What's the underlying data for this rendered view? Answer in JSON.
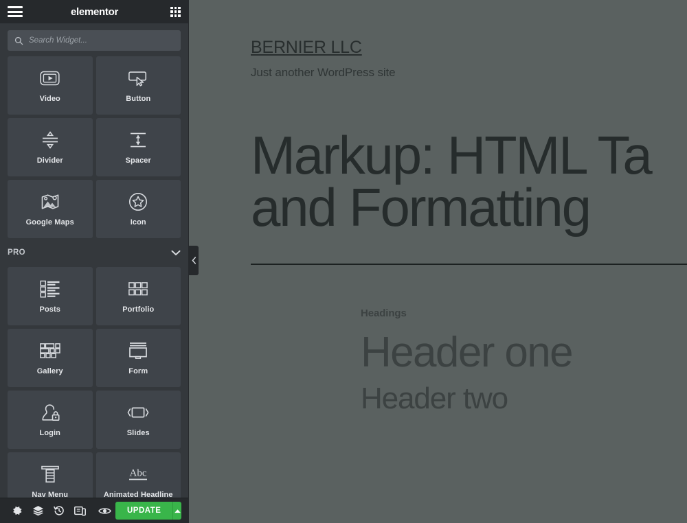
{
  "panel": {
    "header": {
      "menu_icon": "hamburger-icon",
      "brand": "elementor",
      "widgets_grid_icon": "grid-3x3-icon"
    },
    "search": {
      "placeholder": "Search Widget...",
      "value": "",
      "icon": "search-icon"
    },
    "widgets": [
      {
        "label": "Video",
        "icon": "video-player-icon"
      },
      {
        "label": "Button",
        "icon": "button-cursor-icon"
      },
      {
        "label": "Divider",
        "icon": "divider-icon"
      },
      {
        "label": "Spacer",
        "icon": "spacer-icon"
      },
      {
        "label": "Google Maps",
        "icon": "google-maps-icon"
      },
      {
        "label": "Icon",
        "icon": "star-badge-icon"
      }
    ],
    "pro_section": {
      "title": "PRO",
      "chevron_icon": "chevron-down-icon",
      "expanded": true,
      "widgets": [
        {
          "label": "Posts",
          "icon": "posts-list-icon"
        },
        {
          "label": "Portfolio",
          "icon": "portfolio-grid-icon"
        },
        {
          "label": "Gallery",
          "icon": "gallery-grid-icon"
        },
        {
          "label": "Form",
          "icon": "form-window-icon"
        },
        {
          "label": "Login",
          "icon": "login-user-lock-icon"
        },
        {
          "label": "Slides",
          "icon": "slides-carousel-icon"
        },
        {
          "label": "Nav Menu",
          "icon": "nav-menu-icon"
        },
        {
          "label": "Animated Headline",
          "icon": "animated-headline-abc-icon"
        }
      ]
    },
    "footer": {
      "tools": [
        {
          "name": "settings-gear-icon",
          "title": "Settings"
        },
        {
          "name": "navigator-layers-icon",
          "title": "Navigator"
        },
        {
          "name": "history-clock-icon",
          "title": "History"
        },
        {
          "name": "responsive-mode-icon",
          "title": "Responsive Mode"
        },
        {
          "name": "preview-eye-icon",
          "title": "Preview Changes"
        }
      ],
      "update_label": "UPDATE",
      "update_caret_icon": "caret-up-icon",
      "update_color": "#39b54a"
    },
    "collapse_tab_icon": "chevron-left-icon",
    "colors": {
      "panel_bg": "#34383c",
      "header_bg": "#26292c",
      "card_bg": "#3f444a",
      "search_bg": "#4a4f55"
    }
  },
  "preview": {
    "site_title": "BERNIER LLC",
    "site_description": "Just another WordPress site",
    "entry_title_line1": "Markup: HTML Ta",
    "entry_title_line2": "and Formatting",
    "section_label": "Headings",
    "header_one": "Header one",
    "header_two": "Header two",
    "background_color": "#5a6160"
  }
}
